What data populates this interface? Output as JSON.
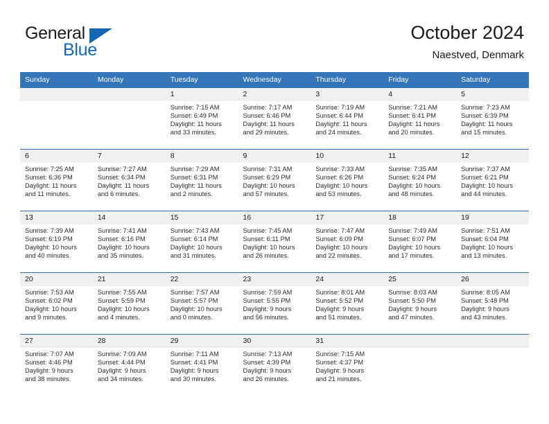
{
  "brand": {
    "name_part1": "General",
    "name_part2": "Blue",
    "logo_icon": "triangle-icon"
  },
  "header": {
    "title": "October 2024",
    "subtitle": "Naestved, Denmark"
  },
  "colors": {
    "header_blue": "#3576b8",
    "row_divider_blue": "#2a6aad",
    "brand_blue": "#1268b3",
    "daynum_band": "#f0f0f0"
  },
  "weekday_headers": [
    "Sunday",
    "Monday",
    "Tuesday",
    "Wednesday",
    "Thursday",
    "Friday",
    "Saturday"
  ],
  "labels": {
    "sunrise_prefix": "Sunrise: ",
    "sunset_prefix": "Sunset: ",
    "daylight_prefix": "Daylight: "
  },
  "weeks": [
    [
      {
        "day": "",
        "empty": true,
        "sunrise": "",
        "sunset": "",
        "daylight_line1": "",
        "daylight_line2": ""
      },
      {
        "day": "",
        "empty": true,
        "sunrise": "",
        "sunset": "",
        "daylight_line1": "",
        "daylight_line2": ""
      },
      {
        "day": "1",
        "sunrise": "Sunrise: 7:15 AM",
        "sunset": "Sunset: 6:49 PM",
        "daylight_line1": "Daylight: 11 hours",
        "daylight_line2": "and 33 minutes."
      },
      {
        "day": "2",
        "sunrise": "Sunrise: 7:17 AM",
        "sunset": "Sunset: 6:46 PM",
        "daylight_line1": "Daylight: 11 hours",
        "daylight_line2": "and 29 minutes."
      },
      {
        "day": "3",
        "sunrise": "Sunrise: 7:19 AM",
        "sunset": "Sunset: 6:44 PM",
        "daylight_line1": "Daylight: 11 hours",
        "daylight_line2": "and 24 minutes."
      },
      {
        "day": "4",
        "sunrise": "Sunrise: 7:21 AM",
        "sunset": "Sunset: 6:41 PM",
        "daylight_line1": "Daylight: 11 hours",
        "daylight_line2": "and 20 minutes."
      },
      {
        "day": "5",
        "sunrise": "Sunrise: 7:23 AM",
        "sunset": "Sunset: 6:39 PM",
        "daylight_line1": "Daylight: 11 hours",
        "daylight_line2": "and 15 minutes."
      }
    ],
    [
      {
        "day": "6",
        "sunrise": "Sunrise: 7:25 AM",
        "sunset": "Sunset: 6:36 PM",
        "daylight_line1": "Daylight: 11 hours",
        "daylight_line2": "and 11 minutes."
      },
      {
        "day": "7",
        "sunrise": "Sunrise: 7:27 AM",
        "sunset": "Sunset: 6:34 PM",
        "daylight_line1": "Daylight: 11 hours",
        "daylight_line2": "and 6 minutes."
      },
      {
        "day": "8",
        "sunrise": "Sunrise: 7:29 AM",
        "sunset": "Sunset: 6:31 PM",
        "daylight_line1": "Daylight: 11 hours",
        "daylight_line2": "and 2 minutes."
      },
      {
        "day": "9",
        "sunrise": "Sunrise: 7:31 AM",
        "sunset": "Sunset: 6:29 PM",
        "daylight_line1": "Daylight: 10 hours",
        "daylight_line2": "and 57 minutes."
      },
      {
        "day": "10",
        "sunrise": "Sunrise: 7:33 AM",
        "sunset": "Sunset: 6:26 PM",
        "daylight_line1": "Daylight: 10 hours",
        "daylight_line2": "and 53 minutes."
      },
      {
        "day": "11",
        "sunrise": "Sunrise: 7:35 AM",
        "sunset": "Sunset: 6:24 PM",
        "daylight_line1": "Daylight: 10 hours",
        "daylight_line2": "and 48 minutes."
      },
      {
        "day": "12",
        "sunrise": "Sunrise: 7:37 AM",
        "sunset": "Sunset: 6:21 PM",
        "daylight_line1": "Daylight: 10 hours",
        "daylight_line2": "and 44 minutes."
      }
    ],
    [
      {
        "day": "13",
        "sunrise": "Sunrise: 7:39 AM",
        "sunset": "Sunset: 6:19 PM",
        "daylight_line1": "Daylight: 10 hours",
        "daylight_line2": "and 40 minutes."
      },
      {
        "day": "14",
        "sunrise": "Sunrise: 7:41 AM",
        "sunset": "Sunset: 6:16 PM",
        "daylight_line1": "Daylight: 10 hours",
        "daylight_line2": "and 35 minutes."
      },
      {
        "day": "15",
        "sunrise": "Sunrise: 7:43 AM",
        "sunset": "Sunset: 6:14 PM",
        "daylight_line1": "Daylight: 10 hours",
        "daylight_line2": "and 31 minutes."
      },
      {
        "day": "16",
        "sunrise": "Sunrise: 7:45 AM",
        "sunset": "Sunset: 6:11 PM",
        "daylight_line1": "Daylight: 10 hours",
        "daylight_line2": "and 26 minutes."
      },
      {
        "day": "17",
        "sunrise": "Sunrise: 7:47 AM",
        "sunset": "Sunset: 6:09 PM",
        "daylight_line1": "Daylight: 10 hours",
        "daylight_line2": "and 22 minutes."
      },
      {
        "day": "18",
        "sunrise": "Sunrise: 7:49 AM",
        "sunset": "Sunset: 6:07 PM",
        "daylight_line1": "Daylight: 10 hours",
        "daylight_line2": "and 17 minutes."
      },
      {
        "day": "19",
        "sunrise": "Sunrise: 7:51 AM",
        "sunset": "Sunset: 6:04 PM",
        "daylight_line1": "Daylight: 10 hours",
        "daylight_line2": "and 13 minutes."
      }
    ],
    [
      {
        "day": "20",
        "sunrise": "Sunrise: 7:53 AM",
        "sunset": "Sunset: 6:02 PM",
        "daylight_line1": "Daylight: 10 hours",
        "daylight_line2": "and 9 minutes."
      },
      {
        "day": "21",
        "sunrise": "Sunrise: 7:55 AM",
        "sunset": "Sunset: 5:59 PM",
        "daylight_line1": "Daylight: 10 hours",
        "daylight_line2": "and 4 minutes."
      },
      {
        "day": "22",
        "sunrise": "Sunrise: 7:57 AM",
        "sunset": "Sunset: 5:57 PM",
        "daylight_line1": "Daylight: 10 hours",
        "daylight_line2": "and 0 minutes."
      },
      {
        "day": "23",
        "sunrise": "Sunrise: 7:59 AM",
        "sunset": "Sunset: 5:55 PM",
        "daylight_line1": "Daylight: 9 hours",
        "daylight_line2": "and 56 minutes."
      },
      {
        "day": "24",
        "sunrise": "Sunrise: 8:01 AM",
        "sunset": "Sunset: 5:52 PM",
        "daylight_line1": "Daylight: 9 hours",
        "daylight_line2": "and 51 minutes."
      },
      {
        "day": "25",
        "sunrise": "Sunrise: 8:03 AM",
        "sunset": "Sunset: 5:50 PM",
        "daylight_line1": "Daylight: 9 hours",
        "daylight_line2": "and 47 minutes."
      },
      {
        "day": "26",
        "sunrise": "Sunrise: 8:05 AM",
        "sunset": "Sunset: 5:48 PM",
        "daylight_line1": "Daylight: 9 hours",
        "daylight_line2": "and 43 minutes."
      }
    ],
    [
      {
        "day": "27",
        "sunrise": "Sunrise: 7:07 AM",
        "sunset": "Sunset: 4:46 PM",
        "daylight_line1": "Daylight: 9 hours",
        "daylight_line2": "and 38 minutes."
      },
      {
        "day": "28",
        "sunrise": "Sunrise: 7:09 AM",
        "sunset": "Sunset: 4:44 PM",
        "daylight_line1": "Daylight: 9 hours",
        "daylight_line2": "and 34 minutes."
      },
      {
        "day": "29",
        "sunrise": "Sunrise: 7:11 AM",
        "sunset": "Sunset: 4:41 PM",
        "daylight_line1": "Daylight: 9 hours",
        "daylight_line2": "and 30 minutes."
      },
      {
        "day": "30",
        "sunrise": "Sunrise: 7:13 AM",
        "sunset": "Sunset: 4:39 PM",
        "daylight_line1": "Daylight: 9 hours",
        "daylight_line2": "and 26 minutes."
      },
      {
        "day": "31",
        "sunrise": "Sunrise: 7:15 AM",
        "sunset": "Sunset: 4:37 PM",
        "daylight_line1": "Daylight: 9 hours",
        "daylight_line2": "and 21 minutes."
      },
      {
        "day": "",
        "empty": true,
        "sunrise": "",
        "sunset": "",
        "daylight_line1": "",
        "daylight_line2": ""
      },
      {
        "day": "",
        "empty": true,
        "sunrise": "",
        "sunset": "",
        "daylight_line1": "",
        "daylight_line2": ""
      }
    ]
  ]
}
